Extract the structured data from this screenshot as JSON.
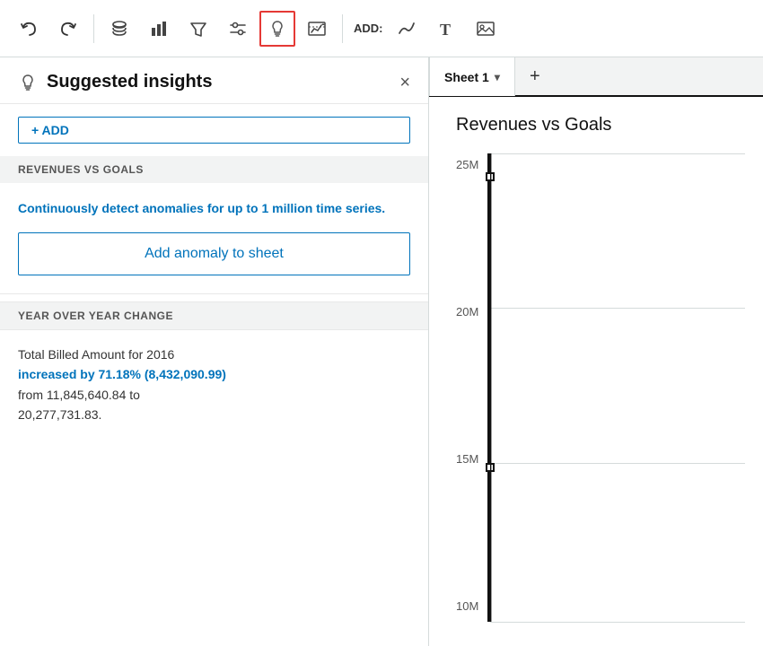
{
  "toolbar": {
    "undo_label": "↺",
    "redo_label": "↻",
    "icons": [
      {
        "name": "undo-icon",
        "symbol": "↺",
        "interactable": true
      },
      {
        "name": "redo-icon",
        "symbol": "↻",
        "interactable": true
      },
      {
        "name": "database-icon",
        "symbol": "⊙",
        "interactable": true
      },
      {
        "name": "bar-chart-icon",
        "symbol": "▦",
        "interactable": true
      },
      {
        "name": "filter-icon",
        "symbol": "⊽",
        "interactable": true
      },
      {
        "name": "sliders-icon",
        "symbol": "⊞",
        "interactable": true
      },
      {
        "name": "insights-icon",
        "symbol": "💡",
        "interactable": true,
        "active": true
      },
      {
        "name": "analysis-icon",
        "symbol": "📊",
        "interactable": true
      }
    ],
    "add_label": "ADD:",
    "add_icons": [
      {
        "name": "add-line-icon",
        "symbol": "∿",
        "interactable": true
      },
      {
        "name": "add-text-icon",
        "symbol": "T",
        "interactable": true
      },
      {
        "name": "add-image-icon",
        "symbol": "⊡",
        "interactable": true
      }
    ]
  },
  "left_panel": {
    "title": "Suggested insights",
    "close_label": "×",
    "add_button_label": "+ ADD",
    "sections": [
      {
        "name": "revenues-vs-goals",
        "header": "REVENUES VS GOALS",
        "anomaly_description": "Continuously detect anomalies for up to 1 million time series.",
        "action_button_label": "Add anomaly to sheet"
      },
      {
        "name": "year-over-year",
        "header": "YEAR OVER YEAR CHANGE",
        "description_line1": "Total Billed Amount for 2016",
        "description_highlight": "increased by 71.18% (8,432,090.99)",
        "description_line2": "from 11,845,640.84 to",
        "description_line3": "20,277,731.83."
      }
    ]
  },
  "right_panel": {
    "sheet_tab_label": "Sheet 1",
    "add_tab_label": "+",
    "chart_title": "Revenues vs Goals",
    "y_axis_labels": [
      "25M",
      "20M",
      "15M",
      "10M"
    ]
  }
}
